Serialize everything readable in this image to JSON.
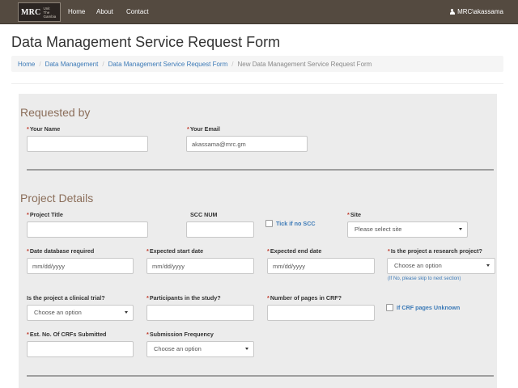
{
  "nav": {
    "logo_main": "MRC",
    "logo_sub_1": "Unit",
    "logo_sub_2": "The Gambia",
    "links": [
      "Home",
      "About",
      "Contact"
    ],
    "user": "MRC\\akassama"
  },
  "page_title": "Data Management Service Request Form",
  "breadcrumb": {
    "items": [
      "Home",
      "Data Management",
      "Data Management Service Request Form"
    ],
    "current": "New Data Management Service Request Form"
  },
  "requested_by": {
    "title": "Requested by",
    "your_name_label": "Your Name",
    "your_name_value": "",
    "your_email_label": "Your Email",
    "your_email_value": "akassama@mrc.gm"
  },
  "project": {
    "title": "Project Details",
    "project_title_label": "Project Title",
    "scc_num_label": "SCC NUM",
    "tick_no_scc_label": "Tick if no SCC",
    "site_label": "Site",
    "site_value": "Please select site",
    "date_db_label": "Date database required",
    "expected_start_label": "Expected start date",
    "expected_end_label": "Expected end date",
    "date_placeholder": "mm/dd/yyyy",
    "research_label": "Is the project a research project?",
    "research_value": "Choose an option",
    "research_hint": "(If No, please skip to next section)",
    "clinical_label": "Is the project a clinical trial?",
    "clinical_value": "Choose an option",
    "participants_label": "Participants in the study?",
    "pages_crf_label": "Number of pages in CRF?",
    "crf_unknown_label": "If CRF pages Unknown",
    "est_crfs_label": "Est. No. Of CRFs Submitted",
    "submission_freq_label": "Submission Frequency",
    "submission_freq_value": "Choose an option"
  },
  "colors": {
    "navbar": "#544a40",
    "section_title": "#8b6e5a",
    "link": "#3c7ab7",
    "required": "#c0392b",
    "panel": "#ececec"
  }
}
